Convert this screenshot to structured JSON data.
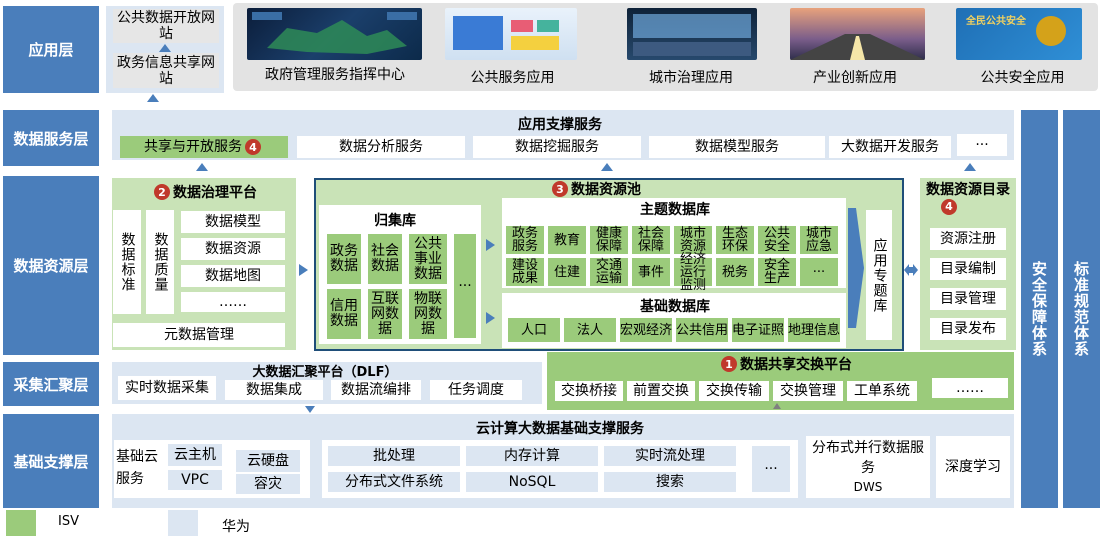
{
  "layers": {
    "app": "应用层",
    "data_service": "数据服务层",
    "data_resource": "数据资源层",
    "collect": "采集汇聚层",
    "base": "基础支撑层"
  },
  "side": {
    "security": "安全保障体系",
    "standard": "标准规范体系"
  },
  "app_layer": {
    "left_boxes": [
      "公共数据开放网站",
      "政务信息共享网站"
    ],
    "apps": [
      "政府管理服务指挥中心",
      "公共服务应用",
      "城市治理应用",
      "产业创新应用",
      "公共安全应用"
    ],
    "thumb_text": "全民公共安全"
  },
  "data_service_layer": {
    "title": "应用支撑服务",
    "items": [
      "共享与开放服务",
      "数据分析服务",
      "数据挖掘服务",
      "数据模型服务",
      "大数据开发服务",
      "···"
    ],
    "badge": "4"
  },
  "governance": {
    "badge": "2",
    "title": "数据治理平台",
    "std": "数据标准",
    "quality": "数据质量",
    "items": [
      "数据模型",
      "数据资源",
      "数据地图",
      "……"
    ],
    "meta": "元数据管理"
  },
  "pool": {
    "badge": "3",
    "title": "数据资源池",
    "collection_title": "归集库",
    "collection_items": [
      "政务数据",
      "社会数据",
      "公共事业数据",
      "···",
      "信用数据",
      "互联网数据",
      "物联网数据"
    ],
    "topic_title": "主题数据库",
    "topic_items": [
      "政务服务",
      "教育",
      "健康保障",
      "社会保障",
      "城市资源",
      "生态环保",
      "公共安全",
      "城市应急",
      "建设成果",
      "住建",
      "交通运输",
      "事件",
      "经济运行监测",
      "税务",
      "安全生产",
      "···"
    ],
    "basic_title": "基础数据库",
    "basic_items": [
      "人口",
      "法人",
      "宏观经济",
      "公共信用",
      "电子证照",
      "地理信息"
    ],
    "app_topic": "应用专题库"
  },
  "catalog": {
    "badge": "4",
    "title": "数据资源目录",
    "items": [
      "资源注册",
      "目录编制",
      "目录管理",
      "目录发布"
    ]
  },
  "collect_layer": {
    "platform": "大数据汇聚平台（DLF）",
    "items": [
      "实时数据采集",
      "数据集成",
      "数据流编排",
      "任务调度"
    ],
    "exchange_badge": "1",
    "exchange_title": "数据共享交换平台",
    "exchange_items": [
      "交换桥接",
      "前置交换",
      "交换传输",
      "交换管理",
      "工单系统",
      "……"
    ]
  },
  "base_layer": {
    "title": "云计算大数据基础支撑服务",
    "cloud_label": "基础云服务",
    "cloud_items": [
      "云主机",
      "云硬盘",
      "VPC",
      "容灾"
    ],
    "mid_items": [
      "批处理",
      "内存计算",
      "实时流处理",
      "分布式文件系统",
      "NoSQL",
      "搜索",
      "···"
    ],
    "dws": "分布式并行数据服务",
    "dws_sub": "DWS",
    "dl": "深度学习"
  },
  "legend": {
    "isv": "ISV",
    "huawei": "华为"
  },
  "colors": {
    "layer_blue": "#4a7ebb",
    "band_light": "#dce6f2",
    "isv_green": "#9bcb7b",
    "badge_red": "#c0392b"
  }
}
